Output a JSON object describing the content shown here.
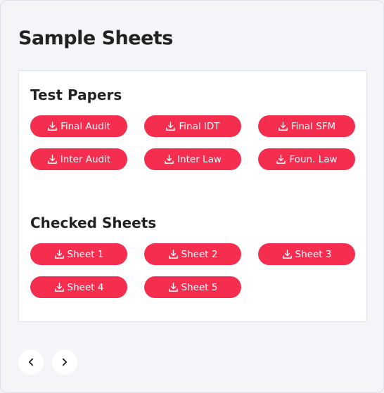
{
  "page": {
    "title": "Sample Sheets"
  },
  "sections": [
    {
      "title": "Test Papers",
      "buttons": [
        "Final Audit",
        "Final IDT",
        "Final SFM",
        "Inter Audit",
        "Inter Law",
        "Foun. Law"
      ]
    },
    {
      "title": "Checked Sheets",
      "buttons": [
        "Sheet 1",
        "Sheet 2",
        "Sheet 3",
        "Sheet 4",
        "Sheet 5"
      ]
    }
  ],
  "icons": {
    "button": "download-icon",
    "prev": "chevron-left-icon",
    "next": "chevron-right-icon"
  },
  "colors": {
    "accent": "#f52d4f",
    "background": "#f4f5f9",
    "card": "#ffffff",
    "text": "#222222"
  }
}
